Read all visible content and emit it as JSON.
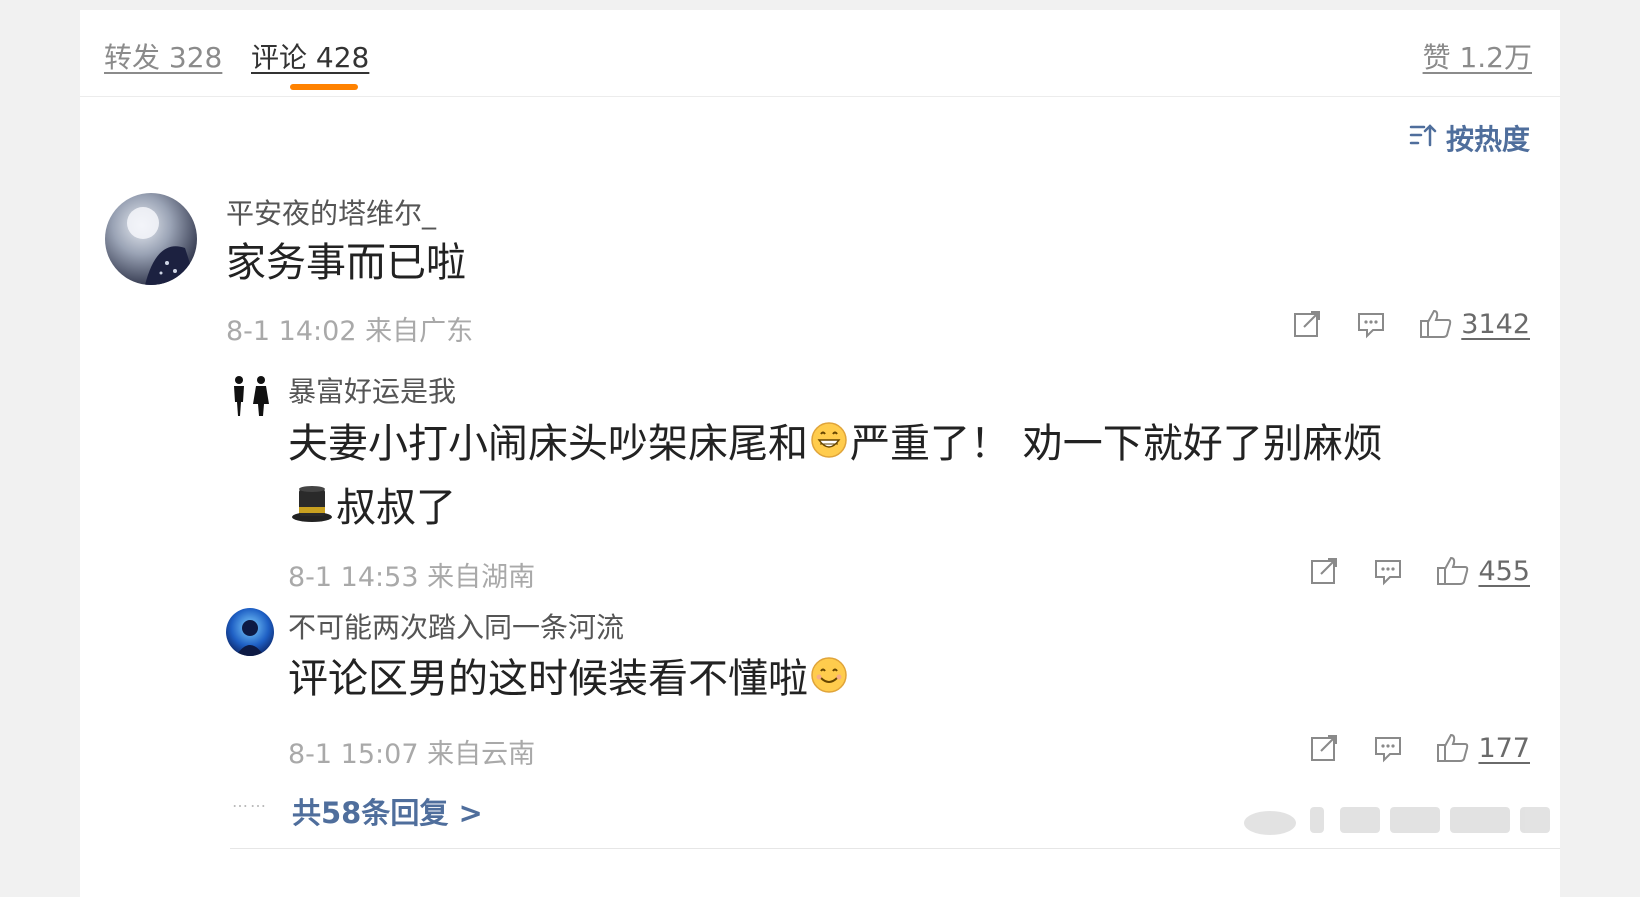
{
  "tabs": {
    "repost": "转发 328",
    "comments": "评论 428",
    "likes": "赞 1.2万"
  },
  "sort": {
    "label": "按热度",
    "icon": "sort-icon"
  },
  "comment": {
    "username": "平安夜的塔维尔_",
    "text": "家务事而已啦",
    "meta": "8-1 14:02 来自广东",
    "likes": "3142"
  },
  "replies": [
    {
      "username": "暴富好运是我",
      "text_part1": "夫妻小打小闹床头吵架床尾和",
      "text_part2": "严重了！ 劝一下就好了别麻烦",
      "text_part3": "叔叔了",
      "meta": "8-1 14:53 来自湖南",
      "likes": "455"
    },
    {
      "username": "不可能两次踏入同一条河流",
      "text_part1": "评论区男的这时候装看不懂啦",
      "meta": "8-1 15:07 来自云南",
      "likes": "177"
    }
  ],
  "more_replies": "共58条回复 >",
  "dots": "……",
  "colors": {
    "accent": "#ff8200",
    "link": "#4f6e9c"
  }
}
